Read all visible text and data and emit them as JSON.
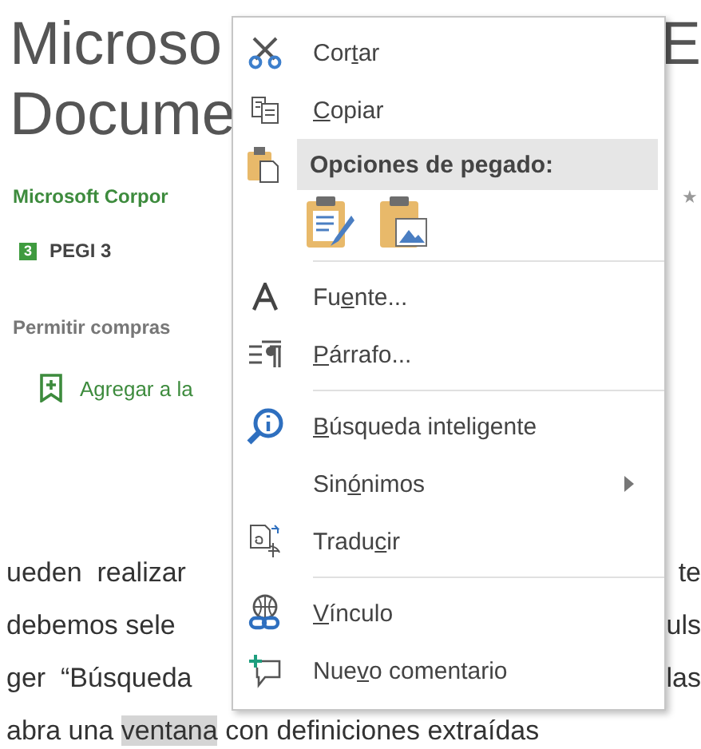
{
  "page": {
    "title_lines": [
      {
        "left": "Microso",
        "right": "E"
      },
      {
        "left": "Docume"
      }
    ],
    "publisher": "Microsoft Corpor",
    "rating_star": "★",
    "pegi": {
      "badge": "3",
      "label": "PEGI 3"
    },
    "purchases": "Permitir compras",
    "wishlist": "Agregar a la",
    "paragraph_lines": [
      {
        "left": "ueden  realizar",
        "right": "te"
      },
      {
        "left": "debemos sele",
        "right": "uls"
      },
      {
        "left": "ger  “Búsqueda",
        "right": "las"
      },
      {
        "left": "abra una ",
        "highlight": "ventana",
        "after": " con definiciones extraídas"
      }
    ]
  },
  "context_menu": {
    "items": [
      {
        "kind": "command",
        "pre": "Cor",
        "key": "t",
        "post": "ar",
        "highlighted": false,
        "submenu": false
      },
      {
        "kind": "command",
        "key": "C",
        "post": "opiar",
        "highlighted": false,
        "submenu": false
      },
      {
        "kind": "header",
        "label": "Opciones de pegado:",
        "highlighted": true
      },
      {
        "kind": "paste-options"
      },
      {
        "kind": "separator"
      },
      {
        "kind": "command",
        "pre": "Fu",
        "key": "e",
        "post": "nte...",
        "highlighted": false,
        "submenu": false
      },
      {
        "kind": "command",
        "key": "P",
        "post": "árrafo...",
        "highlighted": false,
        "submenu": false
      },
      {
        "kind": "separator"
      },
      {
        "kind": "command",
        "key": "B",
        "post": "úsqueda inteligente",
        "highlighted": false,
        "submenu": false
      },
      {
        "kind": "command",
        "pre": "Sin",
        "key": "ó",
        "post": "nimos",
        "highlighted": false,
        "submenu": true
      },
      {
        "kind": "command",
        "pre": "Tradu",
        "key": "c",
        "post": "ir",
        "highlighted": false,
        "submenu": false
      },
      {
        "kind": "separator"
      },
      {
        "kind": "command",
        "key": "V",
        "post": "ínculo",
        "highlighted": false,
        "submenu": false
      },
      {
        "kind": "command",
        "pre": "Nue",
        "key": "v",
        "post": "o comentario",
        "highlighted": false,
        "submenu": false
      }
    ]
  }
}
